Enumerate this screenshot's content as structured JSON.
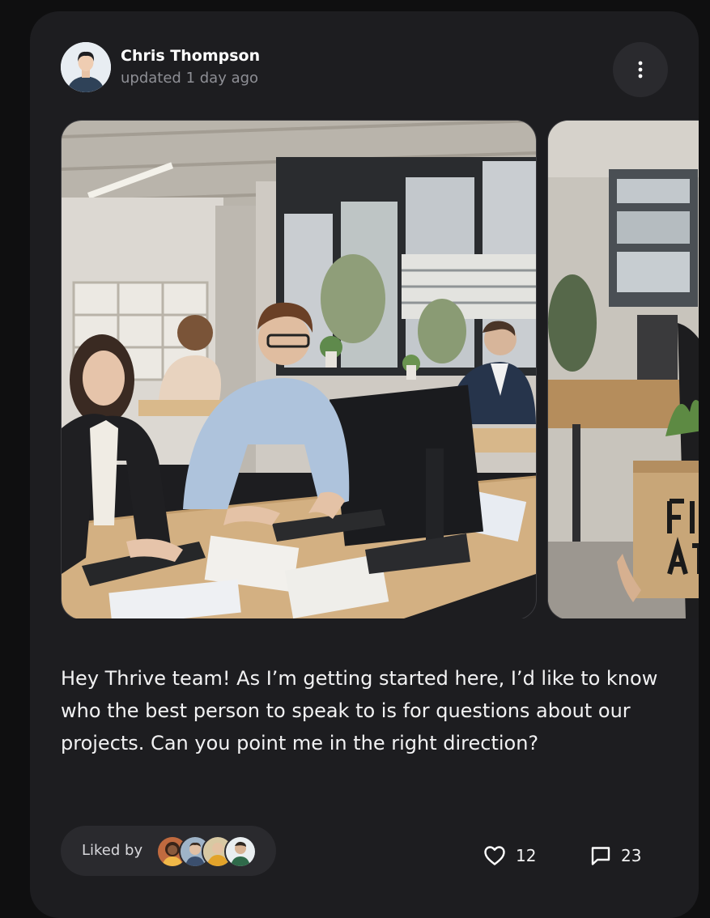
{
  "post": {
    "author_name": "Chris Thompson",
    "updated": "updated 1 day ago",
    "body": "Hey Thrive team! As I’m getting started here, I’d like to know who the best person to speak to is for questions about our projects. Can you point me in the right direction?",
    "image_box_text": "FI\nAT"
  },
  "engagement": {
    "liked_by_label": "Liked by",
    "likes": "12",
    "comments": "23"
  },
  "icons": {
    "more": "more-vertical-icon",
    "like": "heart-icon",
    "comment": "comment-icon"
  },
  "colors": {
    "card_bg": "#1d1d20",
    "pill_bg": "#2a2a2e",
    "muted_text": "#8e8f95"
  }
}
